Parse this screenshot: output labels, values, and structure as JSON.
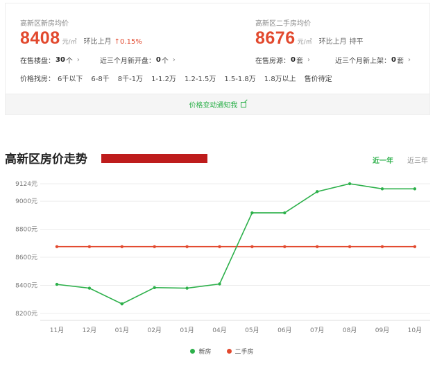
{
  "summary": {
    "new_homes": {
      "title": "高新区新房均价",
      "price": "8408",
      "unit": "元/㎡",
      "mom_label": "环比上月",
      "mom_value": "↑0.15%",
      "listings_label": "在售楼盘：",
      "listings_count": "30",
      "listings_suffix": "个",
      "recent_label": "近三个月新开盘：",
      "recent_count": "0",
      "recent_suffix": "个"
    },
    "second_hand": {
      "title": "高新区二手房均价",
      "price": "8676",
      "unit": "元/㎡",
      "mom_label": "环比上月",
      "mom_value": "持平",
      "listings_label": "在售房源：",
      "listings_count": "0",
      "listings_suffix": "套",
      "recent_label": "近三个月新上架：",
      "recent_count": "0",
      "recent_suffix": "套"
    },
    "filter_label": "价格找房：",
    "filters": [
      "6千以下",
      "6-8千",
      "8千-1万",
      "1-1.2万",
      "1.2-1.5万",
      "1.5-1.8万",
      "1.8万以上",
      "售价待定"
    ],
    "notify_link": "价格变动通知我"
  },
  "trend": {
    "title": "高新区房价走势",
    "tabs": [
      "近一年",
      "近三年"
    ],
    "active_tab": 0
  },
  "colors": {
    "new": "#2cb04a",
    "second": "#e2492e",
    "accent": "#e2492e",
    "link": "#2cb04a"
  },
  "chart_data": {
    "type": "line",
    "categories": [
      "11月",
      "12月",
      "01月",
      "02月",
      "01月",
      "04月",
      "05月",
      "06月",
      "07月",
      "08月",
      "09月",
      "10月"
    ],
    "y_ticks": [
      "8200元",
      "8400元",
      "8600元",
      "8800元",
      "9000元",
      "9124元"
    ],
    "y_tick_values": [
      8200,
      8400,
      8600,
      8800,
      9000,
      9124
    ],
    "ylim": [
      8200,
      9124
    ],
    "series": [
      {
        "name": "新房",
        "color": "#2cb04a",
        "values": [
          8407,
          8380,
          8268,
          8384,
          8380,
          8410,
          8917,
          8917,
          9068,
          9124,
          9088,
          9088
        ]
      },
      {
        "name": "二手房",
        "color": "#e2492e",
        "values": [
          8676,
          8676,
          8676,
          8676,
          8676,
          8676,
          8676,
          8676,
          8676,
          8676,
          8676,
          8676
        ]
      }
    ],
    "grid": true,
    "legend_position": "bottom"
  }
}
